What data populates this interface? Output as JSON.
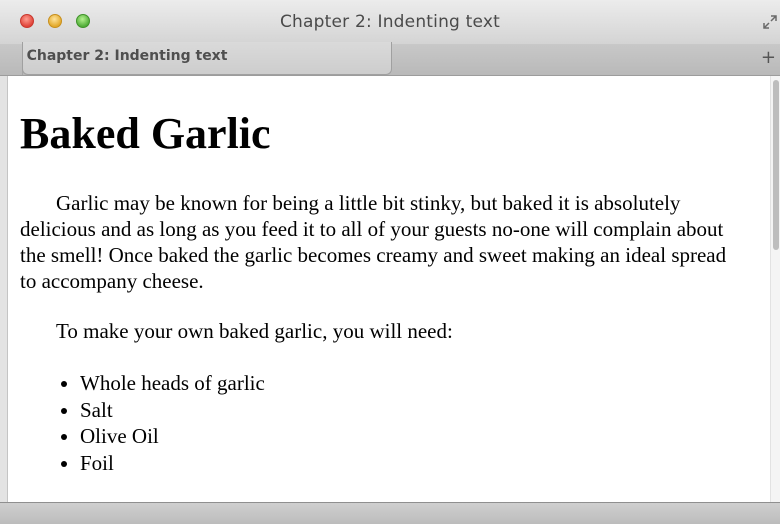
{
  "window": {
    "title": "Chapter 2: Indenting text"
  },
  "tabs": [
    {
      "label": "Chapter 2: Indenting text",
      "active": true
    }
  ],
  "toolbar": {
    "new_tab_label": "+"
  },
  "icons": {
    "close": "close-icon",
    "minimize": "minimize-icon",
    "maximize": "maximize-icon",
    "fullscreen": "fullscreen-icon"
  },
  "colors": {
    "close": "#e0443a",
    "minimize": "#e3a92b",
    "maximize": "#52ae3a"
  },
  "article": {
    "heading": "Baked Garlic",
    "paragraphs": [
      "Garlic may be known for being a little bit stinky, but baked it is absolutely delicious and as long as you feed it to all of your guests no-one will complain about the smell! Once baked the garlic becomes creamy and sweet making an ideal spread to accompany cheese.",
      "To make your own baked garlic, you will need:"
    ],
    "ingredients": [
      "Whole heads of garlic",
      "Salt",
      "Olive Oil",
      "Foil"
    ]
  }
}
